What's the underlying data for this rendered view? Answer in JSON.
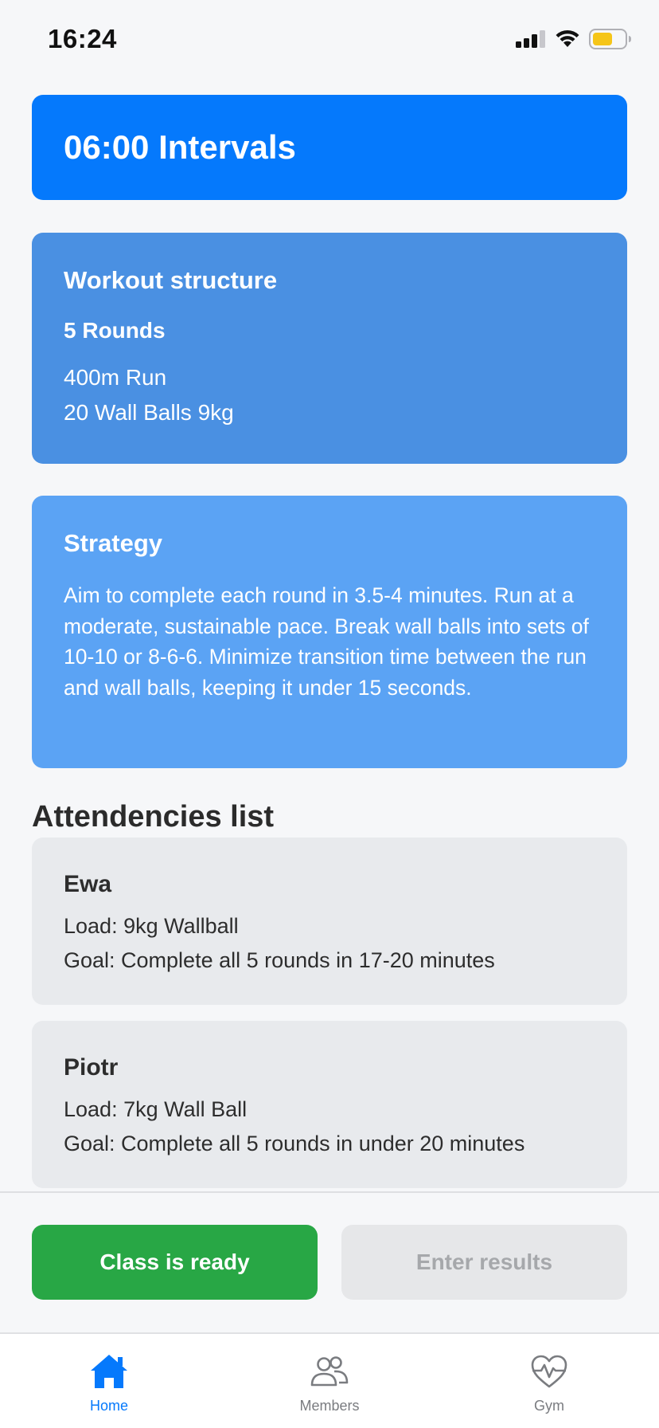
{
  "status_bar": {
    "time": "16:24"
  },
  "header": {
    "title": "06:00 Intervals"
  },
  "workout_structure": {
    "heading": "Workout structure",
    "rounds": "5 Rounds",
    "items": [
      "400m Run",
      "20 Wall Balls 9kg"
    ]
  },
  "strategy": {
    "heading": "Strategy",
    "text": "Aim to complete each round in 3.5-4 minutes. Run at a moderate, sustainable pace. Break wall balls into sets of 10-10 or 8-6-6. Minimize transition time between the run and wall balls, keeping it under 15 seconds."
  },
  "attendance": {
    "title": "Attendencies list",
    "members": [
      {
        "name": "Ewa",
        "load": "Load: 9kg Wallball",
        "goal": "Goal: Complete all 5 rounds in 17-20 minutes"
      },
      {
        "name": "Piotr",
        "load": "Load: 7kg Wall Ball",
        "goal": "Goal: Complete all 5 rounds in under 20 minutes"
      }
    ]
  },
  "actions": {
    "ready_label": "Class is ready",
    "results_label": "Enter results"
  },
  "tab_bar": {
    "active": "home",
    "tabs": [
      {
        "id": "home",
        "label": "Home",
        "icon": "home-icon"
      },
      {
        "id": "members",
        "label": "Members",
        "icon": "members-icon"
      },
      {
        "id": "gym",
        "label": "Gym",
        "icon": "heart-pulse-icon"
      }
    ]
  },
  "colors": {
    "primary": "#0579fc",
    "structure_card": "#4a90e2",
    "strategy_card": "#5ba3f4",
    "success": "#28a745",
    "battery": "#f5c518"
  }
}
